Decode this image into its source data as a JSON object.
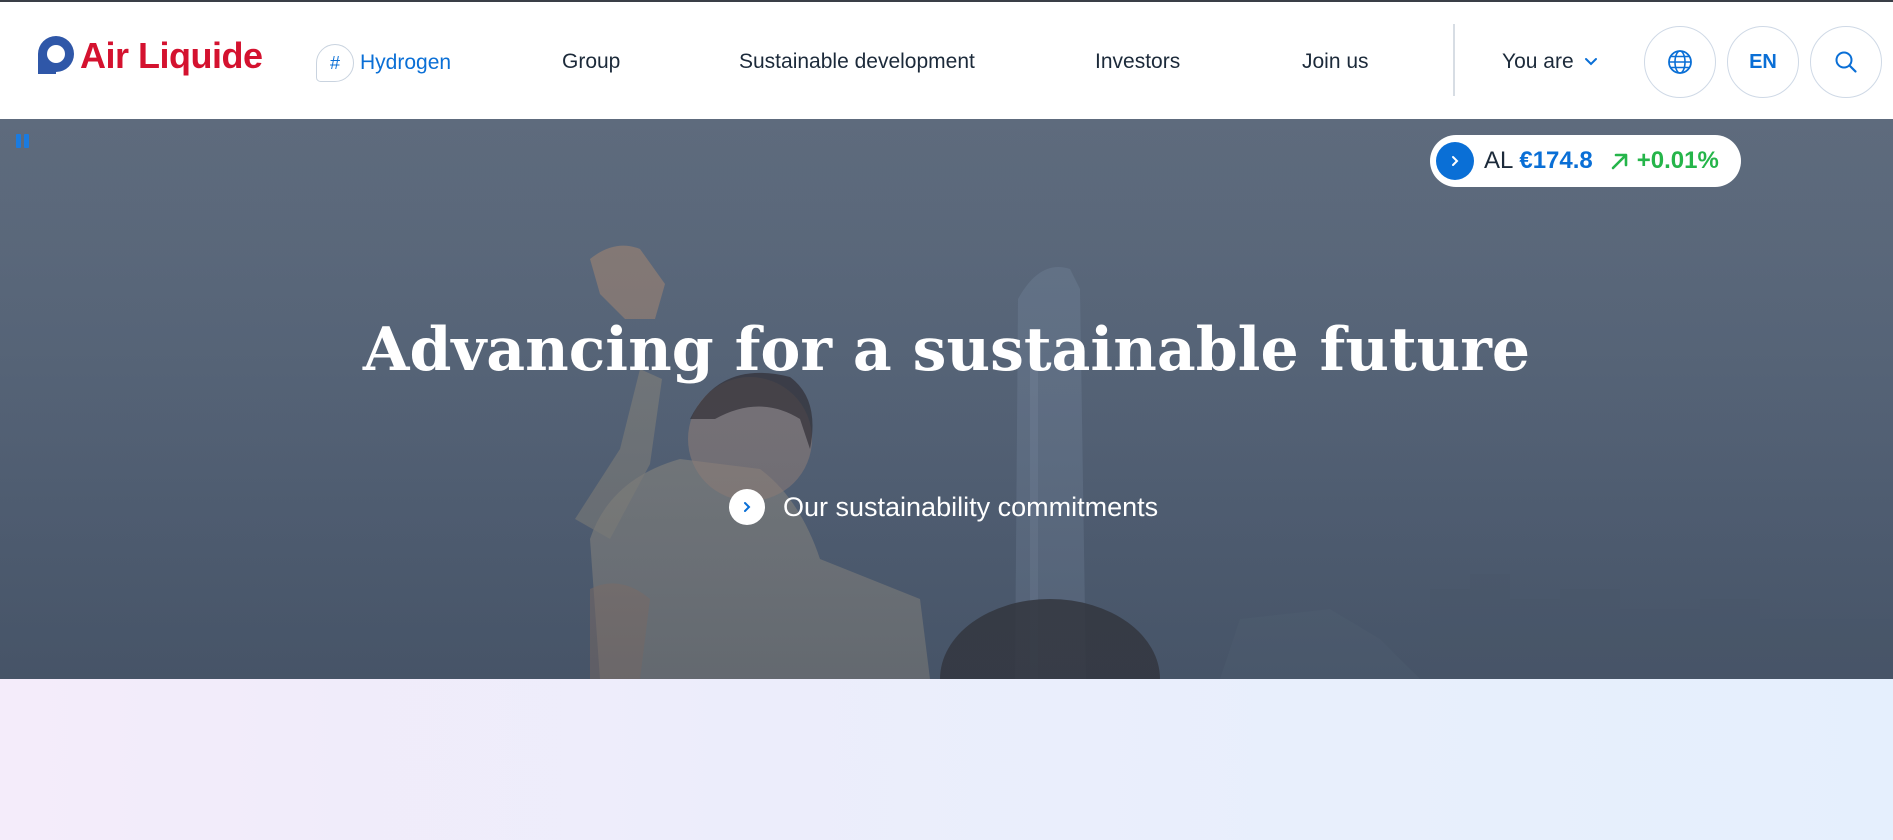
{
  "brand": {
    "name": "Air Liquide",
    "color": "#d4122f",
    "mark_color": "#2f57a8"
  },
  "nav": {
    "hydrogen": {
      "hash": "#",
      "label": "Hydrogen"
    },
    "links": [
      "Group",
      "Sustainable development",
      "Investors",
      "Join us"
    ],
    "you_are": "You are",
    "language": "EN",
    "accent": "#0a6fd6"
  },
  "icons": {
    "globe": "globe-icon",
    "search": "search-icon",
    "chevron": "chevron-down-icon",
    "pause": "pause-icon"
  },
  "ticker": {
    "symbol": "AL",
    "price": "€174.8",
    "change": "+0.01%",
    "trend": "up",
    "change_color": "#25b54a"
  },
  "hero": {
    "title": "Advancing for a sustainable future",
    "cta": "Our sustainability commitments"
  }
}
